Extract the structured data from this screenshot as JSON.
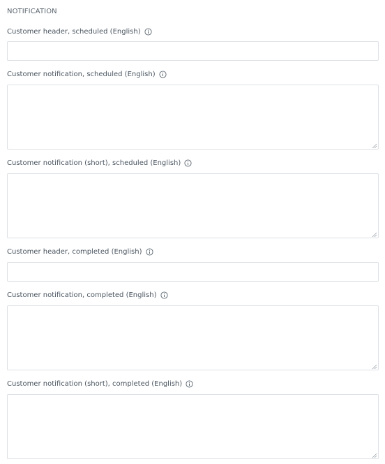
{
  "section": {
    "title": "NOTIFICATION"
  },
  "fields": [
    {
      "label": "Customer header, scheduled (English)",
      "type": "input",
      "value": "",
      "icon": "info-icon"
    },
    {
      "label": "Customer notification, scheduled (English)",
      "type": "textarea",
      "value": "",
      "icon": "info-icon"
    },
    {
      "label": "Customer notification (short), scheduled (English)",
      "type": "textarea",
      "value": "",
      "icon": "info-icon"
    },
    {
      "label": "Customer header, completed (English)",
      "type": "input",
      "value": "",
      "icon": "info-icon"
    },
    {
      "label": "Customer notification, completed (English)",
      "type": "textarea",
      "value": "",
      "icon": "info-icon"
    },
    {
      "label": "Customer notification (short), completed (English)",
      "type": "textarea",
      "value": "",
      "icon": "info-icon"
    }
  ]
}
